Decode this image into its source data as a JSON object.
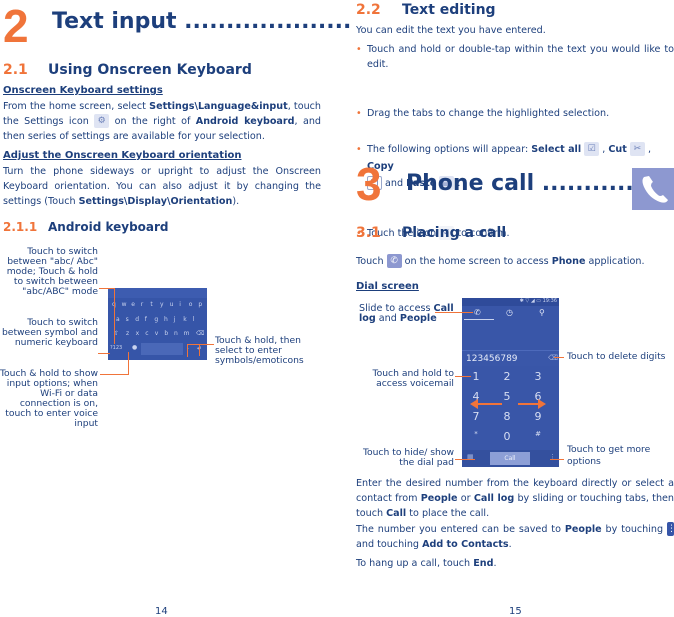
{
  "left_page": {
    "chapter_number": "2",
    "chapter_title": "Text input ....................",
    "section_2_1": {
      "number": "2.1",
      "title": "Using Onscreen Keyboard"
    },
    "settings_heading": "Onscreen Keyboard settings",
    "settings_text": {
      "p1": "From the home screen, select ",
      "b1": "Settings\\Language&input",
      "p2": ", touch the Settings icon ",
      "p3": " on the right of ",
      "b2": "Android keyboard",
      "p4": ", and then series of settings are available for your selection."
    },
    "orientation_heading": "Adjust the Onscreen Keyboard orientation",
    "orientation_text": {
      "p1": "Turn the phone sideways or upright to adjust the Onscreen Keyboard orientation. You can also adjust it by changing the settings (Touch ",
      "b1": "Settings\\Display\\Orientation",
      "p2": ")."
    },
    "section_2_1_1": {
      "number": "2.1.1",
      "title": "Android keyboard"
    },
    "keyboard": {
      "row1": [
        "q",
        "w",
        "e",
        "r",
        "t",
        "y",
        "u",
        "i",
        "o",
        "p"
      ],
      "row2": [
        "a",
        "s",
        "d",
        "f",
        "g",
        "h",
        "j",
        "k",
        "l"
      ],
      "row3": [
        "z",
        "x",
        "c",
        "v",
        "b",
        "n",
        "m"
      ],
      "shift_icon": "⇧",
      "delete_icon": "⌫",
      "symbols_key": "?123",
      "mic_icon": "🎤",
      "period_key": ".",
      "enter_icon": "↵"
    },
    "callouts": {
      "shift": "Touch to switch between \"abc/ Abc\" mode; Touch & hold to switch between \"abc/ABC\" mode",
      "symbols": "Touch to switch between symbol and numeric keyboard",
      "mic": "Touch & hold to show input options; when Wi-Fi or data connection is on, touch to enter voice input",
      "emoticons": "Touch & hold, then select to enter symbols/emoticons"
    },
    "page_number": "14"
  },
  "right_page": {
    "section_2_2": {
      "number": "2.2",
      "title": "Text editing"
    },
    "intro": "You can edit the text you have entered.",
    "bullets": {
      "b1": "Touch and hold or double-tap within the text you would like to edit.",
      "b2": "Drag the tabs to change the highlighted selection.",
      "b3_pre": "The following options will appear: ",
      "select_all": "Select all",
      "cut": "Cut",
      "copy": "Copy",
      "and": " and ",
      "paste": "Paste",
      "b4_pre": "Touch the icon ",
      "b4_post": " to confirm."
    },
    "chapter_number": "3",
    "chapter_title": "Phone call ..............",
    "section_3_1": {
      "number": "3.1",
      "title": "Placing a call"
    },
    "touch_text": {
      "p1": "Touch ",
      "p2": " on the home screen to access ",
      "b1": "Phone",
      "p3": " application."
    },
    "dial_heading": "Dial screen",
    "dialer": {
      "status": "✱ ▽ ◢ ▭ 19:36",
      "number": "123456789",
      "keys": [
        "1",
        "2",
        "3",
        "4",
        "5",
        "6",
        "7",
        "8",
        "9",
        "*",
        "0",
        "#"
      ],
      "call_label": "Call"
    },
    "callouts": {
      "slide_pre": "Slide to access ",
      "slide_b1": "Call",
      "slide_b2": "log",
      "slide_mid": " and ",
      "slide_b3": "People",
      "voicemail": "Touch and hold to access voicemail",
      "hide_pad": "Touch to hide/ show the dial pad",
      "delete": "Touch to delete digits",
      "more": "Touch to get more options"
    },
    "para1": {
      "p1": "Enter the desired number from the keyboard directly or select a contact from ",
      "b1": "People",
      "p2": " or ",
      "b2": "Call log",
      "p3": " by sliding or touching tabs, then touch ",
      "b3": "Call",
      "p4": " to place the call."
    },
    "para2": {
      "p1": "The number you entered can be saved to ",
      "b1": "People",
      "p2": " by touching ",
      "p3": " and touching ",
      "b2": "Add to Contacts",
      "p4": "."
    },
    "para3": {
      "p1": "To hang up a call, touch ",
      "b1": "End",
      "p2": "."
    },
    "page_number": "15"
  },
  "colors": {
    "navy": "#1d3f7c",
    "orange": "#f0743a",
    "keyboard_blue": "#3655a8"
  }
}
